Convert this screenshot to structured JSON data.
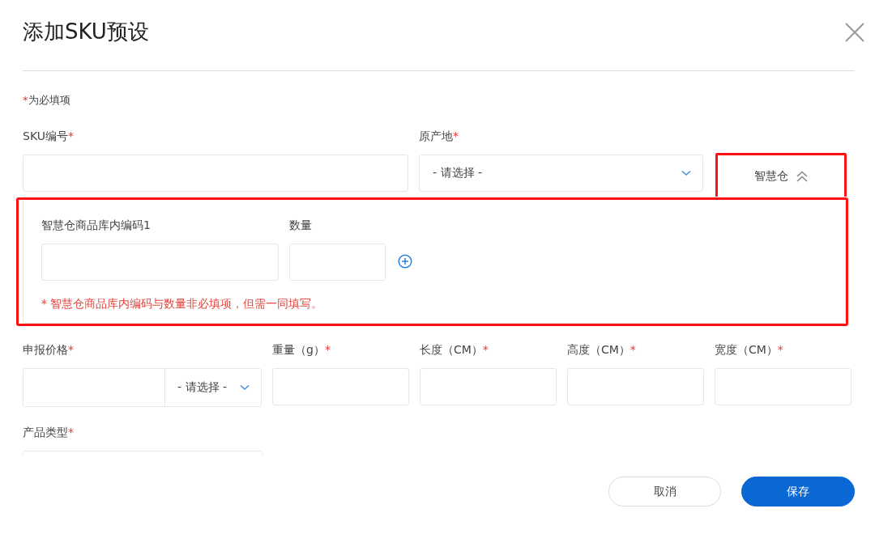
{
  "dialog": {
    "title": "添加SKU预设",
    "required_note": {
      "mark": "*",
      "text": "为必填项"
    }
  },
  "row_1": [
    {
      "kind": "input",
      "label": "SKU编号",
      "mark": "*"
    },
    {
      "kind": "select",
      "label": "原产地",
      "mark": "*",
      "placeholder": "- 请选择 -"
    }
  ],
  "smart_warehouse": {
    "button": "智慧仓",
    "expanded": true,
    "highlighted": true,
    "fields": [
      {
        "kind": "input",
        "label": "智慧仓商品库内编码1"
      },
      {
        "kind": "input",
        "label": "数量"
      }
    ],
    "note": "* 智慧仓商品库内编码与数量非必填项，但需一同填写。"
  },
  "row_2": [
    {
      "kind": "price",
      "label": "申报价格",
      "mark": "*",
      "placeholder": "- 请选择 -"
    },
    {
      "kind": "input",
      "label": "重量（g）",
      "mark": "*"
    },
    {
      "kind": "input",
      "label": "长度（CM）",
      "mark": "*"
    },
    {
      "kind": "input",
      "label": "高度（CM）",
      "mark": "*"
    },
    {
      "kind": "input",
      "label": "宽度（CM）",
      "mark": "*"
    }
  ],
  "row_3": [
    {
      "kind": "clipped",
      "label": "产品类型",
      "mark": "*"
    }
  ],
  "buttons": [
    {
      "kind": "secondary",
      "label": "取消"
    },
    {
      "kind": "primary",
      "label": "保存"
    }
  ]
}
